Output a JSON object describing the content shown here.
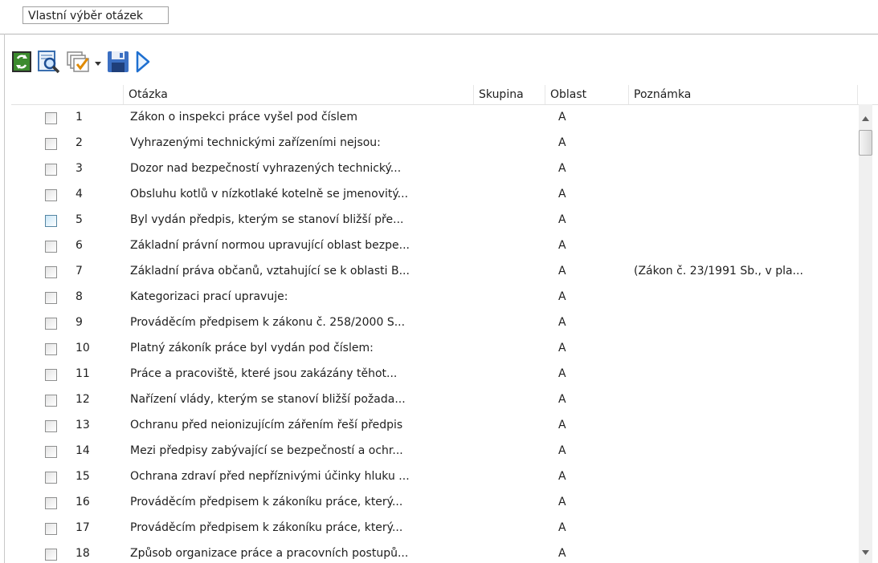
{
  "window": {
    "title": "Vlastní výběr otázek"
  },
  "toolbar": {
    "buttons": [
      {
        "name": "refresh-button",
        "icon": "refresh-icon"
      },
      {
        "name": "preview-button",
        "icon": "magnify-document-icon"
      },
      {
        "name": "select-menu-button",
        "icon": "checklist-dropdown-icon"
      },
      {
        "name": "save-button",
        "icon": "floppy-disk-icon"
      },
      {
        "name": "run-button",
        "icon": "play-arrow-icon"
      }
    ]
  },
  "table": {
    "columns": [
      "Otázka",
      "Skupina",
      "Oblast",
      "Poznámka"
    ],
    "rows": [
      {
        "num": "1",
        "question": "Zákon o inspekci práce vyšel pod číslem",
        "group": "",
        "area": "A",
        "note": ""
      },
      {
        "num": "2",
        "question": "Vyhrazenými technickými zařízeními nejsou:",
        "group": "",
        "area": "A",
        "note": ""
      },
      {
        "num": "3",
        "question": "Dozor nad bezpečností vyhrazených technický...",
        "group": "",
        "area": "A",
        "note": ""
      },
      {
        "num": "4",
        "question": "Obsluhu kotlů v nízkotlaké kotelně se jmenovitý...",
        "group": "",
        "area": "A",
        "note": ""
      },
      {
        "num": "5",
        "question": "Byl vydán předpis, kterým se stanoví bližší pře...",
        "group": "",
        "area": "A",
        "note": ""
      },
      {
        "num": "6",
        "question": "Základní právní normou upravující oblast bezpe...",
        "group": "",
        "area": "A",
        "note": ""
      },
      {
        "num": "7",
        "question": "Základní práva občanů, vztahující se k oblasti B...",
        "group": "",
        "area": "A",
        "note": "(Zákon č. 23/1991 Sb., v pla..."
      },
      {
        "num": "8",
        "question": "Kategorizaci prací upravuje:",
        "group": "",
        "area": "A",
        "note": ""
      },
      {
        "num": "9",
        "question": "Prováděcím předpisem k zákonu č. 258/2000 S...",
        "group": "",
        "area": "A",
        "note": ""
      },
      {
        "num": "10",
        "question": "Platný zákoník práce byl vydán pod číslem:",
        "group": "",
        "area": "A",
        "note": ""
      },
      {
        "num": "11",
        "question": "Práce a pracoviště, které jsou zakázány těhot...",
        "group": "",
        "area": "A",
        "note": ""
      },
      {
        "num": "12",
        "question": "Nařízení vlády, kterým se stanoví bližší požada...",
        "group": "",
        "area": "A",
        "note": ""
      },
      {
        "num": "13",
        "question": "Ochranu před neionizujícím zářením řeší předpis",
        "group": "",
        "area": "A",
        "note": ""
      },
      {
        "num": "14",
        "question": "Mezi předpisy zabývající se bezpečností a ochr...",
        "group": "",
        "area": "A",
        "note": ""
      },
      {
        "num": "15",
        "question": "Ochrana zdraví před nepříznivými účinky hluku ...",
        "group": "",
        "area": "A",
        "note": ""
      },
      {
        "num": "16",
        "question": "Prováděcím předpisem k zákoníku práce, který...",
        "group": "",
        "area": "A",
        "note": ""
      },
      {
        "num": "17",
        "question": "Prováděcím předpisem k zákoníku práce,  který...",
        "group": "",
        "area": "A",
        "note": ""
      },
      {
        "num": "18",
        "question": "Způsob organizace práce a pracovních postupů...",
        "group": "",
        "area": "A",
        "note": ""
      }
    ]
  },
  "colors": {
    "accent": "#1e6fd0",
    "hover_checkbox": "#c9e6f8"
  }
}
